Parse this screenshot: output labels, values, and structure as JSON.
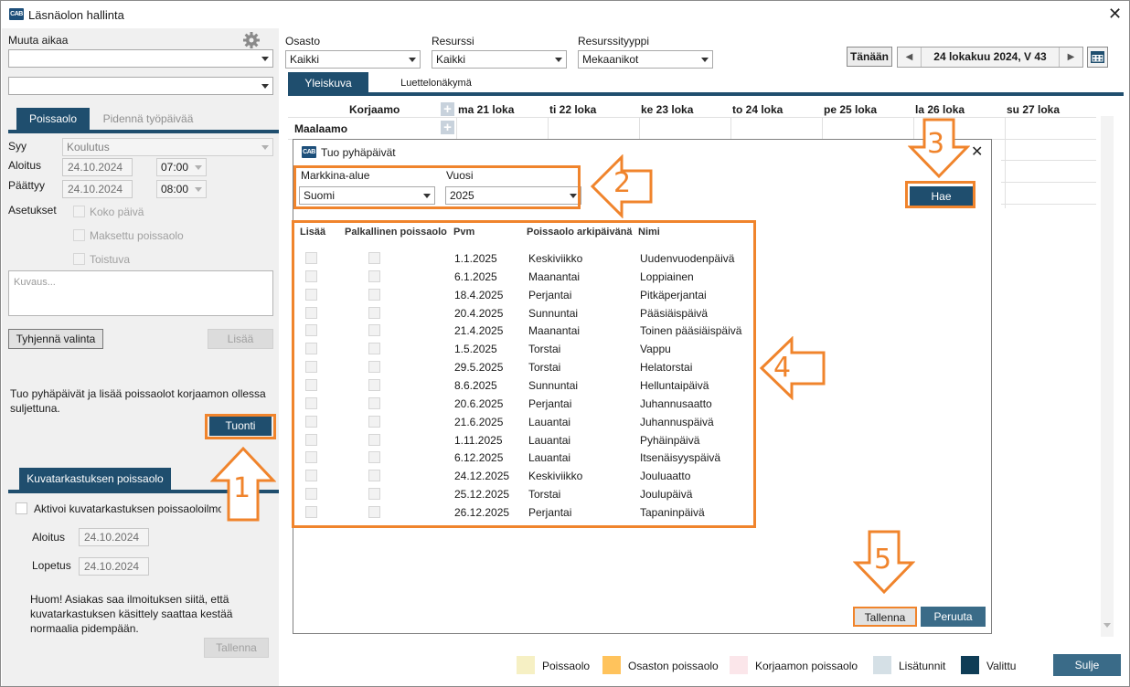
{
  "window": {
    "title": "Läsnäolon hallinta",
    "app_icon": "CAB"
  },
  "left": {
    "change_time_label": "Muuta aikaa",
    "combo1": "",
    "combo2": "",
    "tabs": [
      "Poissaolo",
      "Pidennä työpäivää"
    ],
    "reason_label": "Syy",
    "reason_value": "Koulutus",
    "start_label": "Aloitus",
    "start_date": "24.10.2024",
    "start_time": "07:00",
    "end_label": "Päättyy",
    "end_date": "24.10.2024",
    "end_time": "08:00",
    "settings_label": "Asetukset",
    "options": [
      "Koko päivä",
      "Maksettu poissaolo",
      "Toistuva"
    ],
    "description_placeholder": "Kuvaus...",
    "clear_button": "Tyhjennä valinta",
    "add_button": "Lisää",
    "import_text": "Tuo pyhäpäivät ja lisää poissaolot korjaamon ollessa suljettuna.",
    "import_button": "Tuonti",
    "inspection_tab": "Kuvatarkastuksen poissaolo",
    "inspection_checkbox": "Aktivoi kuvatarkastuksen poissaoloilmoitus",
    "insp_start_label": "Aloitus",
    "insp_start_date": "24.10.2024",
    "insp_end_label": "Lopetus",
    "insp_end_date": "24.10.2024",
    "notice": "Huom! Asiakas saa ilmoituksen siitä, että kuvatarkastuksen käsittely saattaa kestää normaalia pidempään.",
    "save_button": "Tallenna"
  },
  "filters": {
    "department_label": "Osasto",
    "department_value": "Kaikki",
    "resource_label": "Resurssi",
    "resource_value": "Kaikki",
    "resource_type_label": "Resurssityyppi",
    "resource_type_value": "Mekaanikot"
  },
  "nav": {
    "today_button": "Tänään",
    "prev": "◀",
    "next": "▶",
    "current_period": "24 lokakuu 2024, V 43"
  },
  "view_tabs": [
    "Yleiskuva",
    "Luettelonäkymä"
  ],
  "calendar": {
    "workshop_header": "Korjaamo",
    "days": [
      "ma 21 loka",
      "ti 22 loka",
      "ke 23 loka",
      "to 24 loka",
      "pe 25 loka",
      "la 26 loka",
      "su 27 loka"
    ],
    "rows": [
      "Maalaamo"
    ]
  },
  "dialog": {
    "title": "Tuo pyhäpäivät",
    "market_label": "Markkina-alue",
    "market_value": "Suomi",
    "year_label": "Vuosi",
    "year_value": "2025",
    "fetch_button": "Hae",
    "columns": [
      "Lisää",
      "Palkallinen poissaolo",
      "Pvm",
      "Poissaolo arkipäivänä",
      "Nimi"
    ],
    "holidays": [
      {
        "date": "1.1.2025",
        "weekday": "Keskiviikko",
        "name": "Uudenvuodenpäivä"
      },
      {
        "date": "6.1.2025",
        "weekday": "Maanantai",
        "name": "Loppiainen"
      },
      {
        "date": "18.4.2025",
        "weekday": "Perjantai",
        "name": "Pitkäperjantai"
      },
      {
        "date": "20.4.2025",
        "weekday": "Sunnuntai",
        "name": "Pääsiäispäivä"
      },
      {
        "date": "21.4.2025",
        "weekday": "Maanantai",
        "name": "Toinen pääsiäispäivä"
      },
      {
        "date": "1.5.2025",
        "weekday": "Torstai",
        "name": "Vappu"
      },
      {
        "date": "29.5.2025",
        "weekday": "Torstai",
        "name": "Helatorstai"
      },
      {
        "date": "8.6.2025",
        "weekday": "Sunnuntai",
        "name": "Helluntaipäivä"
      },
      {
        "date": "20.6.2025",
        "weekday": "Perjantai",
        "name": "Juhannusaatto"
      },
      {
        "date": "21.6.2025",
        "weekday": "Lauantai",
        "name": "Juhannuspäivä"
      },
      {
        "date": "1.11.2025",
        "weekday": "Lauantai",
        "name": "Pyhäinpäivä"
      },
      {
        "date": "6.12.2025",
        "weekday": "Lauantai",
        "name": "Itsenäisyyspäivä"
      },
      {
        "date": "24.12.2025",
        "weekday": "Keskiviikko",
        "name": "Jouluaatto"
      },
      {
        "date": "25.12.2025",
        "weekday": "Torstai",
        "name": "Joulupäivä"
      },
      {
        "date": "26.12.2025",
        "weekday": "Perjantai",
        "name": "Tapaninpäivä"
      }
    ],
    "save_button": "Tallenna",
    "cancel_button": "Peruuta"
  },
  "legend": [
    {
      "label": "Poissaolo",
      "color": "#f6f0c4"
    },
    {
      "label": "Osaston poissaolo",
      "color": "#ffc35c"
    },
    {
      "label": "Korjaamon poissaolo",
      "color": "#fbe6ea"
    },
    {
      "label": "Lisätunnit",
      "color": "#d5e0e6"
    },
    {
      "label": "Valittu",
      "color": "#0f3d56"
    }
  ],
  "close_button": "Sulje",
  "callouts": [
    "1",
    "2",
    "3",
    "4",
    "5"
  ],
  "colors": {
    "accent": "#1f4e6e",
    "callout": "#f0842c"
  }
}
